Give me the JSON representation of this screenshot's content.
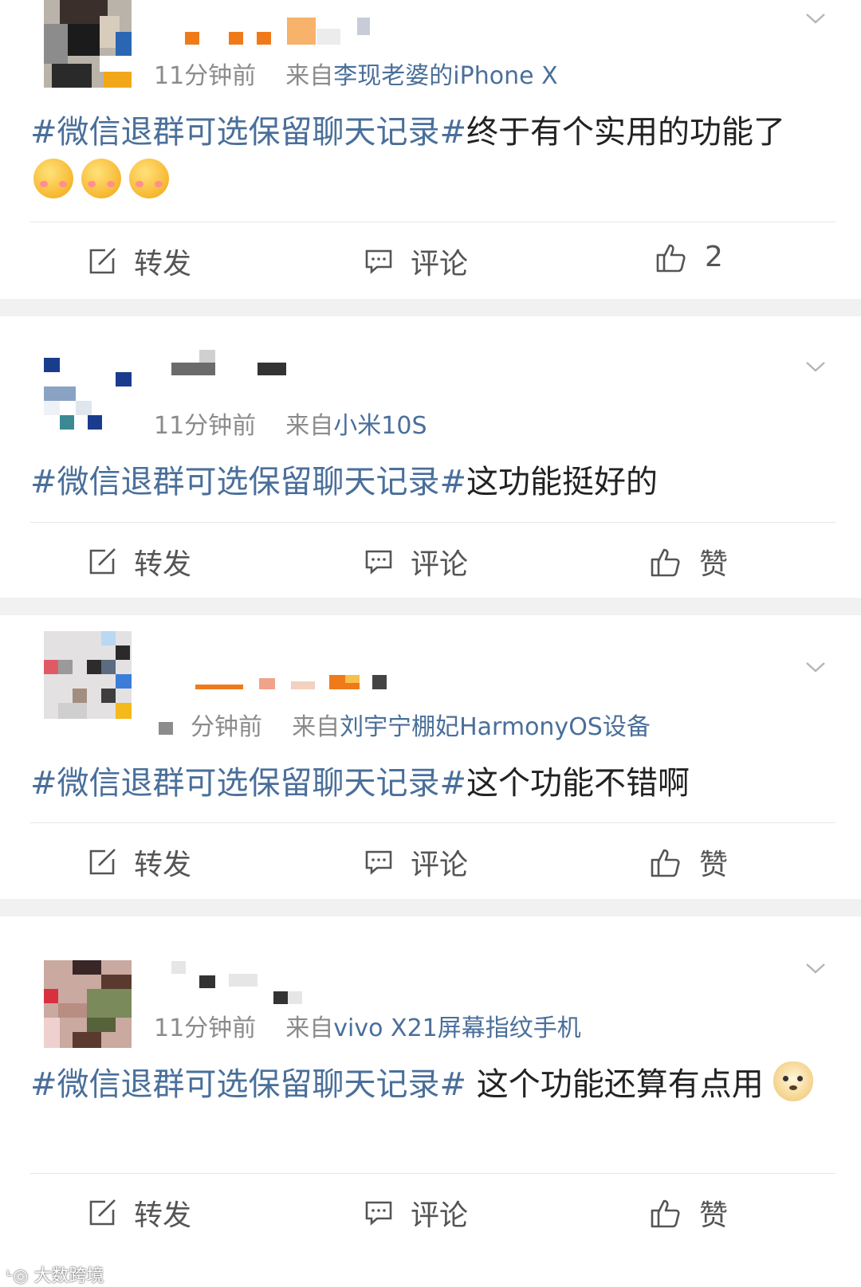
{
  "posts": [
    {
      "time": "11分钟前",
      "from": "来自",
      "source": "李现老婆的iPhone X",
      "topic": "#微信退群可选保留聊天记录#",
      "text": "终于有个实用的功能了",
      "emojis": [
        "shy-face",
        "shy-face",
        "shy-face"
      ],
      "repost": "转发",
      "comment": "评论",
      "like": "2"
    },
    {
      "time": "11分钟前",
      "from": "来自",
      "source": "小米10S",
      "topic": "#微信退群可选保留聊天记录#",
      "text": "这功能挺好的",
      "emojis": [],
      "repost": "转发",
      "comment": "评论",
      "like": "赞"
    },
    {
      "time": "分钟前",
      "from": "来自",
      "source": "刘宇宁棚妃HarmonyOS设备",
      "topic": "#微信退群可选保留聊天记录#",
      "text": "这个功能不错啊",
      "emojis": [],
      "repost": "转发",
      "comment": "评论",
      "like": "赞"
    },
    {
      "time": "11分钟前",
      "from": "来自",
      "source": "vivo X21屏幕指纹手机",
      "topic": "#微信退群可选保留聊天记录#",
      "text": " 这个功能还算有点用",
      "emojis": [
        "doge"
      ],
      "repost": "转发",
      "comment": "评论",
      "like": "赞"
    }
  ],
  "watermark": "大数跨境",
  "colors": {
    "topic": "#4a6f9a",
    "separator": "#f1f1f1",
    "meta": "#8b8b8b"
  }
}
